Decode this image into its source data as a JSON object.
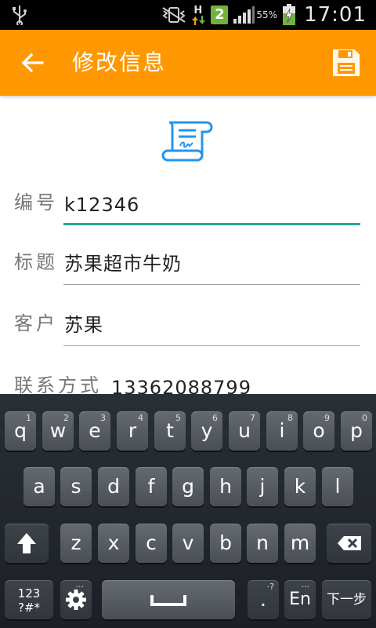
{
  "status_bar": {
    "network_letter": "H",
    "sim_slot": "2",
    "battery_percent": "55%",
    "time": "17:01",
    "icons": [
      "usb-icon",
      "vibrate-mute-icon",
      "network-activity-icon",
      "sim-icon",
      "signal-icon",
      "battery-charging-icon"
    ]
  },
  "header": {
    "title": "修改信息",
    "back_icon": "arrow-back-icon",
    "save_icon": "save-icon",
    "color": "#ff9800"
  },
  "form": {
    "doc_icon": "contract-scroll-icon",
    "fields": [
      {
        "label": "编号",
        "value": "k12346",
        "focused": true
      },
      {
        "label": "标题",
        "value": "苏果超市牛奶",
        "focused": false
      },
      {
        "label": "客户",
        "value": "苏果",
        "focused": false
      },
      {
        "label": "联系方式",
        "value": "13362088799",
        "focused": false
      }
    ],
    "accent_color": "#26a69a"
  },
  "keyboard": {
    "row1": [
      {
        "main": "q",
        "sup": "1"
      },
      {
        "main": "w",
        "sup": "2"
      },
      {
        "main": "e",
        "sup": "3"
      },
      {
        "main": "r",
        "sup": "4"
      },
      {
        "main": "t",
        "sup": "5"
      },
      {
        "main": "y",
        "sup": "6"
      },
      {
        "main": "u",
        "sup": "7"
      },
      {
        "main": "i",
        "sup": "8"
      },
      {
        "main": "o",
        "sup": "9"
      },
      {
        "main": "p",
        "sup": "0"
      }
    ],
    "row2": [
      "a",
      "s",
      "d",
      "f",
      "g",
      "h",
      "j",
      "k",
      "l"
    ],
    "row3": [
      "z",
      "x",
      "c",
      "v",
      "b",
      "n",
      "m"
    ],
    "shift_icon": "shift-icon",
    "backspace_icon": "backspace-icon",
    "symbols_label": "123\n?#*",
    "settings_icon": "gear-icon",
    "space_icon": "space-icon",
    "period_label": ".",
    "period_sup": "·?",
    "lang_label": "En",
    "next_label": "下一步"
  }
}
